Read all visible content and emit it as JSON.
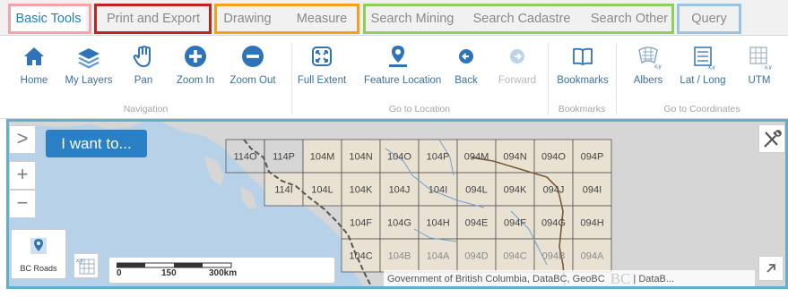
{
  "tabs": [
    {
      "label": "Basic Tools",
      "active": true
    },
    {
      "label": "Print and Export",
      "active": false
    },
    {
      "label": "Drawing",
      "active": false
    },
    {
      "label": "Measure",
      "active": false
    },
    {
      "label": "Search Mining",
      "active": false
    },
    {
      "label": "Search Cadastre",
      "active": false
    },
    {
      "label": "Search Other",
      "active": false
    },
    {
      "label": "Query",
      "active": false
    }
  ],
  "ribbon": {
    "buttons": [
      {
        "label": "Home",
        "icon": "home-icon"
      },
      {
        "label": "My Layers",
        "icon": "layers-icon"
      },
      {
        "label": "Pan",
        "icon": "hand-icon"
      },
      {
        "label": "Zoom In",
        "icon": "zoom-in-icon"
      },
      {
        "label": "Zoom Out",
        "icon": "zoom-out-icon"
      },
      {
        "label": "Full Extent",
        "icon": "full-extent-icon"
      },
      {
        "label": "Feature Location",
        "icon": "location-pin-icon"
      },
      {
        "label": "Back",
        "icon": "back-arrow-icon"
      },
      {
        "label": "Forward",
        "icon": "forward-arrow-icon",
        "disabled": true
      },
      {
        "label": "Bookmarks",
        "icon": "book-icon"
      },
      {
        "label": "Albers",
        "icon": "albers-icon"
      },
      {
        "label": "Lat / Long",
        "icon": "lat-long-icon"
      },
      {
        "label": "UTM",
        "icon": "utm-grid-icon"
      }
    ],
    "groups": [
      "Navigation",
      "Go to Location",
      "Bookmarks",
      "Go to Coordinates"
    ]
  },
  "map": {
    "want_label": "I want to...",
    "expand_glyph": ">",
    "zoom_in_glyph": "+",
    "zoom_out_glyph": "−",
    "basemap_label": "BC Roads",
    "scale_labels": [
      "0",
      "150",
      "300km"
    ],
    "attribution": "Government of British Columbia, DataBC, GeoBC",
    "attribution_logo": "BC",
    "attribution_tail": "| DataB...",
    "grid_labels": [
      "114O",
      "114P",
      "104M",
      "104N",
      "104O",
      "104P",
      "094M",
      "094N",
      "094O",
      "094P",
      "114I",
      "104L",
      "104K",
      "104J",
      "104I",
      "094L",
      "094K",
      "094J",
      "094I",
      "104F",
      "104G",
      "104H",
      "094E",
      "094F",
      "094G",
      "094H",
      "104C",
      "104B",
      "104A",
      "094D",
      "094C",
      "094B",
      "094A"
    ],
    "colors": {
      "water": "#b7d2e8",
      "land": "#d6d6d6",
      "grid_fill": "#ece4d2",
      "accent": "#2b7fc4"
    }
  }
}
